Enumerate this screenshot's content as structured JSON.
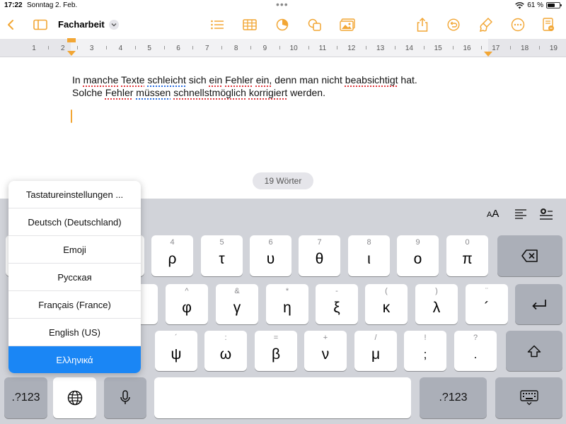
{
  "status_bar": {
    "time": "17:22",
    "date": "Sonntag 2. Feb.",
    "battery": "61 %",
    "battery_level": 0.61
  },
  "toolbar": {
    "document_title": "Facharbeit",
    "accent_color": "#f2a634",
    "left_icons": [
      "back-chevron-icon",
      "sidebar-icon"
    ],
    "center_icons": [
      "list-icon",
      "table-icon",
      "chart-icon",
      "shapes-icon",
      "media-icon"
    ],
    "right_icons": [
      "share-icon",
      "undo-icon",
      "format-brush-icon",
      "more-icon",
      "document-options-icon"
    ]
  },
  "ruler": {
    "numbers": [
      "1",
      "2",
      "3",
      "4",
      "5",
      "6",
      "7",
      "8",
      "9",
      "10",
      "11",
      "12",
      "13",
      "14",
      "15",
      "16",
      "17",
      "18",
      "19"
    ]
  },
  "document": {
    "line1": {
      "segments": [
        {
          "text": "In ",
          "mark": ""
        },
        {
          "text": "manche",
          "mark": "red"
        },
        {
          "text": " ",
          "mark": ""
        },
        {
          "text": "Texte",
          "mark": "red"
        },
        {
          "text": " ",
          "mark": ""
        },
        {
          "text": "schleicht",
          "mark": "blue"
        },
        {
          "text": " sich ",
          "mark": ""
        },
        {
          "text": "ein",
          "mark": "red"
        },
        {
          "text": " ",
          "mark": ""
        },
        {
          "text": "Fehler",
          "mark": "red"
        },
        {
          "text": " ",
          "mark": ""
        },
        {
          "text": "ein,",
          "mark": "red"
        },
        {
          "text": " denn man nicht ",
          "mark": ""
        },
        {
          "text": "beabsichtigt",
          "mark": "red"
        },
        {
          "text": " hat.",
          "mark": ""
        }
      ]
    },
    "line2": {
      "segments": [
        {
          "text": "Solche ",
          "mark": ""
        },
        {
          "text": "Fehler",
          "mark": "red"
        },
        {
          "text": " ",
          "mark": ""
        },
        {
          "text": "müssen",
          "mark": "blue"
        },
        {
          "text": " ",
          "mark": ""
        },
        {
          "text": "schnellstmöglich",
          "mark": "red"
        },
        {
          "text": " ",
          "mark": ""
        },
        {
          "text": "korrigiert",
          "mark": "red"
        },
        {
          "text": " werden.",
          "mark": ""
        }
      ]
    }
  },
  "word_count": "19 Wörter",
  "keyboard_bar": {
    "text_size_label": "AA",
    "icons": [
      "text-size-icon",
      "align-icon",
      "insert-icon"
    ]
  },
  "keyboard": {
    "row1": [
      {
        "sec": "4",
        "pri": "ρ"
      },
      {
        "sec": "5",
        "pri": "τ"
      },
      {
        "sec": "6",
        "pri": "υ"
      },
      {
        "sec": "7",
        "pri": "θ"
      },
      {
        "sec": "8",
        "pri": "ι"
      },
      {
        "sec": "9",
        "pri": "ο"
      },
      {
        "sec": "0",
        "pri": "π"
      }
    ],
    "row2": [
      {
        "sec": "^",
        "pri": "φ"
      },
      {
        "sec": "&",
        "pri": "γ"
      },
      {
        "sec": "*",
        "pri": "η"
      },
      {
        "sec": "-",
        "pri": "ξ"
      },
      {
        "sec": "(",
        "pri": "κ"
      },
      {
        "sec": ")",
        "pri": "λ"
      },
      {
        "sec": "¨",
        "pri": "´"
      }
    ],
    "row3": [
      {
        "sec": "´",
        "pri": "ψ"
      },
      {
        "sec": ":",
        "pri": "ω"
      },
      {
        "sec": "=",
        "pri": "β"
      },
      {
        "sec": "+",
        "pri": "ν"
      },
      {
        "sec": "/",
        "pri": "μ"
      },
      {
        "sec": "!",
        "pri": ";"
      },
      {
        "sec": "?",
        "pri": "."
      }
    ],
    "numbers_left": ".?123",
    "numbers_right": ".?123",
    "delete_icon": "delete-icon",
    "return_icon": "return-icon",
    "shift_icon": "shift-icon",
    "globe_icon": "globe-icon",
    "mic_icon": "microphone-icon",
    "hide_keyboard_icon": "hide-keyboard-icon"
  },
  "language_menu": {
    "items": [
      "Tastatureinstellungen ...",
      "Deutsch (Deutschland)",
      "Emoji",
      "Русская",
      "Français (France)",
      "English (US)",
      "Ελληνικά"
    ],
    "selected": "Ελληνικά",
    "selected_color": "#1a86f5"
  }
}
